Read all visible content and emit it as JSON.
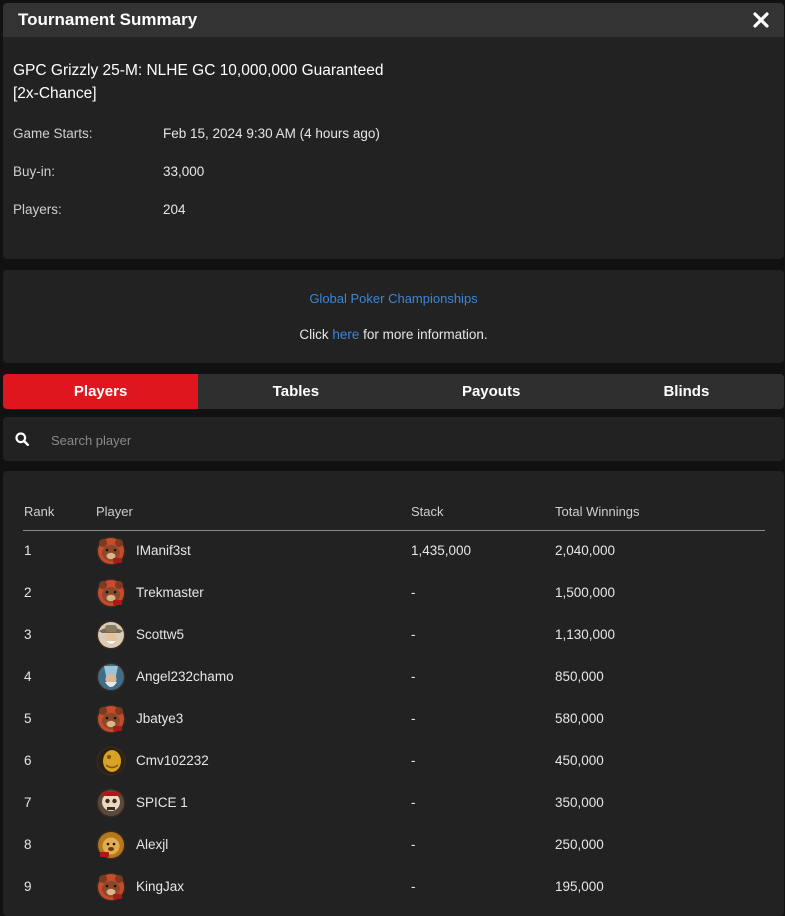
{
  "header": {
    "title": "Tournament Summary",
    "close_icon": "close-icon"
  },
  "tournament": {
    "name_line1": "GPC Grizzly 25-M: NLHE GC 10,000,000 Guaranteed",
    "name_line2": "[2x-Chance]",
    "details": [
      {
        "label": "Game Starts:",
        "value": "Feb 15, 2024 9:30 AM (4 hours ago)"
      },
      {
        "label": "Buy-in:",
        "value": "33,000"
      },
      {
        "label": "Players:",
        "value": "204"
      }
    ]
  },
  "promo": {
    "link": "Global Poker Championships",
    "text_before": "Click ",
    "link_here": "here",
    "text_after": " for more information."
  },
  "tabs": [
    {
      "label": "Players",
      "active": true
    },
    {
      "label": "Tables",
      "active": false
    },
    {
      "label": "Payouts",
      "active": false
    },
    {
      "label": "Blinds",
      "active": false
    }
  ],
  "search": {
    "placeholder": "Search player",
    "icon": "search-icon"
  },
  "table": {
    "headers": {
      "rank": "Rank",
      "player": "Player",
      "stack": "Stack",
      "winnings": "Total Winnings"
    },
    "rows": [
      {
        "rank": "1",
        "player": "IManif3st",
        "stack": "1,435,000",
        "winnings": "2,040,000",
        "avatar": "bear"
      },
      {
        "rank": "2",
        "player": "Trekmaster",
        "stack": "-",
        "winnings": "1,500,000",
        "avatar": "bear"
      },
      {
        "rank": "3",
        "player": "Scottw5",
        "stack": "-",
        "winnings": "1,130,000",
        "avatar": "cowboy"
      },
      {
        "rank": "4",
        "player": "Angel232chamo",
        "stack": "-",
        "winnings": "850,000",
        "avatar": "wizard"
      },
      {
        "rank": "5",
        "player": "Jbatye3",
        "stack": "-",
        "winnings": "580,000",
        "avatar": "bear"
      },
      {
        "rank": "6",
        "player": "Cmv102232",
        "stack": "-",
        "winnings": "450,000",
        "avatar": "gold"
      },
      {
        "rank": "7",
        "player": "SPICE 1",
        "stack": "-",
        "winnings": "350,000",
        "avatar": "skull"
      },
      {
        "rank": "8",
        "player": "Alexjl",
        "stack": "-",
        "winnings": "250,000",
        "avatar": "lion"
      },
      {
        "rank": "9",
        "player": "KingJax",
        "stack": "-",
        "winnings": "195,000",
        "avatar": "bear"
      }
    ]
  },
  "colors": {
    "accent": "#e0161f",
    "link": "#3a86d8",
    "panel": "#222222",
    "background": "#111111"
  }
}
